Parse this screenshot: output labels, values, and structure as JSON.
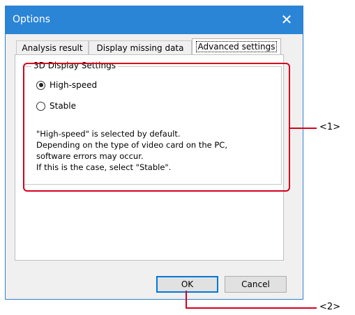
{
  "window": {
    "title": "Options",
    "close_glyph": "✕"
  },
  "tabs": [
    {
      "label": "Analysis result"
    },
    {
      "label": "Display missing data"
    },
    {
      "label": "Advanced settings"
    }
  ],
  "group": {
    "title": "3D Display Settings",
    "options": [
      {
        "label": "High-speed",
        "checked": true
      },
      {
        "label": "Stable",
        "checked": false
      }
    ],
    "description": [
      "\"High-speed\" is selected by default.",
      "Depending on the type of video card on the PC,",
      "software errors may occur.",
      "If this is the case, select \"Stable\"."
    ]
  },
  "buttons": {
    "ok": "OK",
    "cancel": "Cancel"
  },
  "callouts": {
    "one": "<1>",
    "two": "<2>"
  },
  "colors": {
    "titlebar": "#2b85d6",
    "callout": "#d6001c",
    "default_button_border": "#0078d7"
  }
}
